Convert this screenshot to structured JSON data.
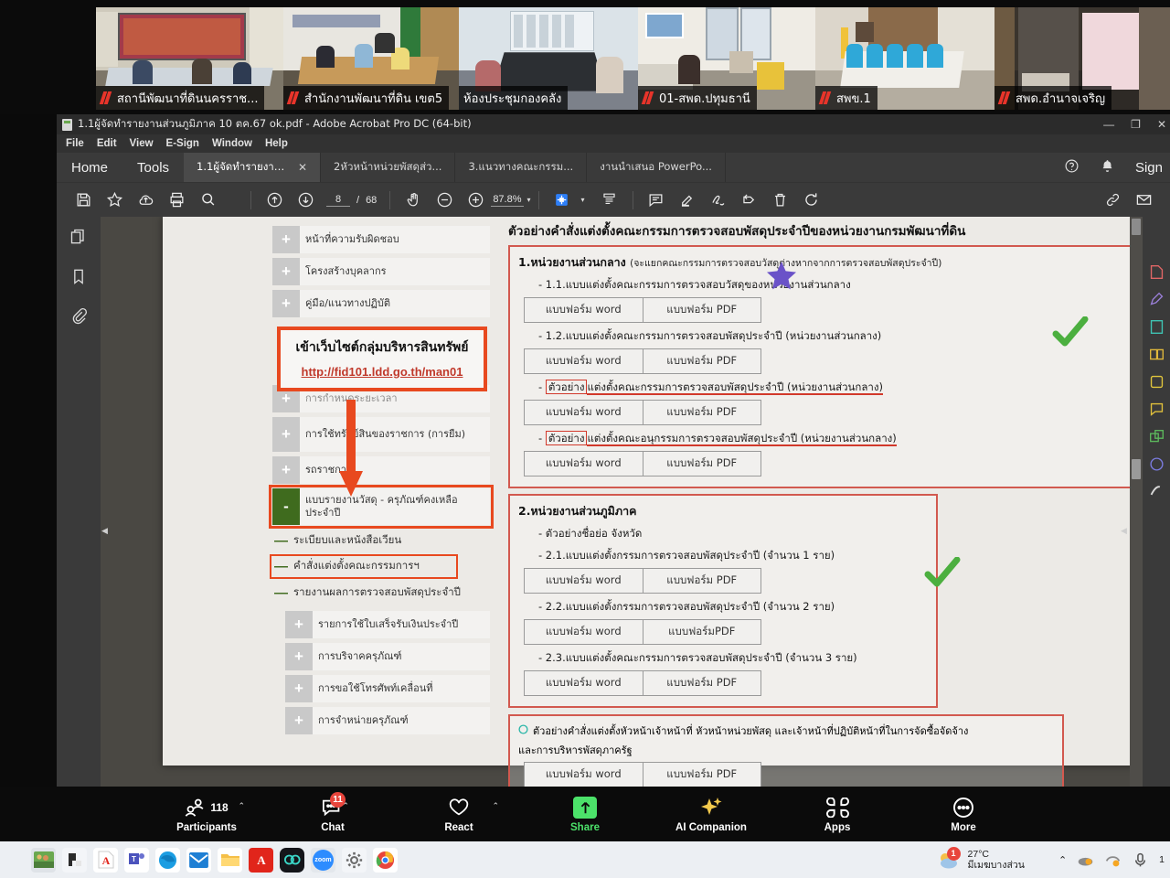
{
  "gallery": {
    "tiles": [
      {
        "label": "สถานีพัฒนาที่ดินนครราช...",
        "active": false
      },
      {
        "label": "สำนักงานพัฒนาที่ดิน เขต5",
        "active": false
      },
      {
        "label": "ห้องประชุมกองคลัง",
        "active": true
      },
      {
        "label": "01-สพด.ปทุมธานี",
        "active": false
      },
      {
        "label": "สพข.1",
        "active": false
      },
      {
        "label": "สพด.อำนาจเจริญ",
        "active": false
      }
    ]
  },
  "acrobat": {
    "title": "1.1ผู้จัดทำรายงานส่วนภูมิภาค 10 ตค.67 ok.pdf - Adobe Acrobat Pro DC (64-bit)",
    "window_buttons": {
      "minimize": "—",
      "maximize": "❐",
      "close": "✕"
    },
    "menu": [
      "File",
      "Edit",
      "View",
      "E-Sign",
      "Window",
      "Help"
    ],
    "home_label": "Home",
    "tools_label": "Tools",
    "tabs": [
      {
        "label": "1.1ผู้จัดทำรายงานส่วน...",
        "selected": true,
        "close": "✕"
      },
      {
        "label": "2หัวหน้าหน่วยพัสดุส่ว...",
        "selected": false
      },
      {
        "label": "3.แนวทางคณะกรรม...",
        "selected": false
      },
      {
        "label": "งานนำเสนอ PowerPo...",
        "selected": false
      }
    ],
    "sign_label": "Sign",
    "toolbar": {
      "page_current": "8",
      "page_sep": "/",
      "page_total": "68",
      "zoom_level": "87.8%",
      "caret": "▾"
    }
  },
  "pdf": {
    "outline": [
      {
        "sign": "+",
        "label": "หน้าที่ความรับผิดชอบ"
      },
      {
        "sign": "+",
        "label": "โครงสร้างบุคลากร"
      },
      {
        "sign": "+",
        "label": "คู่มือ/แนวทางปฏิบัติ"
      },
      {
        "sign": "+",
        "label": "การกำหนดระยะเวลา"
      },
      {
        "sign": "+",
        "label": "การใช้ทรัพย์สินของราชการ (การยืม)"
      },
      {
        "sign": "+",
        "label": "รถราชการ"
      },
      {
        "sign": "-",
        "label": "แบบรายงานวัสดุ - ครุภัณฑ์คงเหลือประจำปี",
        "highlight": true
      },
      {
        "sign": "+",
        "label": "รายการใช้ใบเสร็จรับเงินประจำปี"
      },
      {
        "sign": "+",
        "label": "การบริจาคครุภัณฑ์"
      },
      {
        "sign": "+",
        "label": "การขอใช้โทรศัพท์เคลื่อนที่"
      },
      {
        "sign": "+",
        "label": "การจำหน่ายครุภัณฑ์"
      }
    ],
    "sub_items": [
      {
        "label": "ระเบียบและหนังสือเวียน",
        "boxed": false
      },
      {
        "label": "คำสั่งแต่งตั้งคณะกรรมการฯ",
        "boxed": true
      },
      {
        "label": "รายงานผลการตรวจสอบพัสดุประจำปี",
        "boxed": false
      }
    ],
    "url_callout": {
      "heading": "เข้าเว็บไซต์กลุ่มบริหารสินทรัพย์",
      "link": "http://fid101.ldd.go.th/man01"
    },
    "content_title": "ตัวอย่างคำสั่งแต่งตั้งคณะกรรมการตรวจสอบพัสดุประจำปีของหน่วยงานกรมพัฒนาที่ดิน",
    "btn_word": "แบบฟอร์ม word",
    "btn_pdf": "แบบฟอร์ม PDF",
    "btn_pdf_nospace": "แบบฟอร์มPDF",
    "sections": [
      {
        "heading": "1.หน่วยงานส่วนกลาง",
        "heading_sub": "(จะแยกคณะกรรมการตรวจสอบวัสดุต่างหากจากการตรวจสอบพัสดุประจำปี)",
        "items": [
          {
            "text": "- 1.1.แบบแต่งตั้งคณะกรรมการตรวจสอบวัสดุของหน่วยงานส่วนกลาง",
            "word": "แบบฟอร์ม word",
            "pdf": "แบบฟอร์ม PDF"
          },
          {
            "text": "- 1.2.แบบแต่งตั้งคณะกรรมการตรวจสอบพัสดุประจำปี (หน่วยงานส่วนกลาง)",
            "word": "แบบฟอร์ม word",
            "pdf": "แบบฟอร์ม PDF"
          },
          {
            "prefix": "- ",
            "boxed": "ตัวอย่าง",
            "text": "แต่งตั้งคณะกรรมการตรวจสอบพัสดุประจำปี (หน่วยงานส่วนกลาง)",
            "word": "แบบฟอร์ม word",
            "pdf": "แบบฟอร์ม PDF"
          },
          {
            "prefix": "- ",
            "boxed": "ตัวอย่าง",
            "text": "แต่งตั้งคณะอนุกรรมการตรวจสอบพัสดุประจำปี (หน่วยงานส่วนกลาง)",
            "word": "แบบฟอร์ม word",
            "pdf": "แบบฟอร์ม PDF"
          }
        ]
      },
      {
        "heading": "2.หน่วยงานส่วนภูมิภาค",
        "heading_sub": "",
        "items": [
          {
            "text": "- ตัวอย่างชื่อย่อ จังหวัด"
          },
          {
            "text": "- 2.1.แบบแต่งตั้งกรรมการตรวจสอบพัสดุประจำปี (จำนวน 1 ราย)",
            "word": "แบบฟอร์ม word",
            "pdf": "แบบฟอร์ม PDF"
          },
          {
            "text": "- 2.2.แบบแต่งตั้งกรรมการตรวจสอบพัสดุประจำปี (จำนวน 2 ราย)",
            "word": "แบบฟอร์ม word",
            "pdf": "แบบฟอร์มPDF"
          },
          {
            "text": "- 2.3.แบบแต่งตั้งคณะกรรมการตรวจสอบพัสดุประจำปี (จำนวน 3 ราย)",
            "word": "แบบฟอร์ม word",
            "pdf": "แบบฟอร์ม PDF"
          }
        ]
      },
      {
        "heading": "",
        "heading_sub": "",
        "items": [
          {
            "text": "ตัวอย่างคำสั่งแต่งตั้งหัวหน้าเจ้าหน้าที่ หัวหน้าหน่วยพัสดุ และเจ้าหน้าที่ปฏิบัติหน้าที่ในการจัดซื้อจัดจ้าง"
          },
          {
            "text": "และการบริหารพัสดุภาครัฐ",
            "word": "แบบฟอร์ม word",
            "pdf": "แบบฟอร์ม PDF"
          }
        ]
      }
    ]
  },
  "zoombar": {
    "items": [
      {
        "name": "participants",
        "label": "Participants",
        "count": "118",
        "chevron": "⌃",
        "badge": ""
      },
      {
        "name": "chat",
        "label": "Chat",
        "count": "",
        "chevron": "⌃",
        "badge": "11"
      },
      {
        "name": "react",
        "label": "React",
        "count": "",
        "chevron": "⌃",
        "badge": ""
      },
      {
        "name": "share",
        "label": "Share",
        "count": "",
        "chevron": "",
        "badge": ""
      },
      {
        "name": "ai-companion",
        "label": "AI Companion",
        "count": "",
        "chevron": "",
        "badge": ""
      },
      {
        "name": "apps",
        "label": "Apps",
        "count": "",
        "chevron": "",
        "badge": ""
      },
      {
        "name": "more",
        "label": "More",
        "count": "",
        "chevron": "",
        "badge": ""
      }
    ]
  },
  "taskbar": {
    "apps": [
      {
        "name": "photo-app",
        "glyph": "",
        "bg": "#6aa84f",
        "active": true
      },
      {
        "name": "file-explorer-dark",
        "glyph": "",
        "bg": "#2b2b2b",
        "active": false
      },
      {
        "name": "adobe-acrobat",
        "glyph": "A",
        "bg": "#ffffff",
        "active": false
      },
      {
        "name": "microsoft-teams",
        "glyph": "T",
        "bg": "#ffffff",
        "active": false
      },
      {
        "name": "microsoft-edge",
        "glyph": "e",
        "bg": "#ffffff",
        "active": false
      },
      {
        "name": "mail",
        "glyph": "✉",
        "bg": "#ffffff",
        "active": false
      },
      {
        "name": "file-explorer",
        "glyph": "",
        "bg": "#ffffff",
        "active": false
      },
      {
        "name": "adobe-red",
        "glyph": "A",
        "bg": "#e1251b",
        "active": false
      },
      {
        "name": "dark-app",
        "glyph": "∞",
        "bg": "#1a1a1a",
        "active": false
      },
      {
        "name": "zoom",
        "glyph": "zoom",
        "bg": "#2d8cff",
        "active": true
      },
      {
        "name": "settings",
        "glyph": "⚙",
        "bg": "#ffffff",
        "active": false
      },
      {
        "name": "google-chrome",
        "glyph": "",
        "bg": "#ffffff",
        "active": false
      }
    ],
    "weather": {
      "temp": "27°C",
      "desc": "มีเมฆบางส่วน",
      "badge": "1"
    },
    "tray_caret": "⌃",
    "clock": {
      "time": "1",
      "date": ""
    }
  }
}
